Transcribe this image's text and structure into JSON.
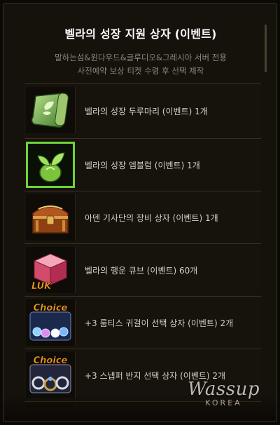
{
  "popup": {
    "title": "벨라의 성장 지원 상자 (이벤트)",
    "description_line1": "말하는섬&윈다우드&글루디오&그레시아 서버 전용",
    "description_line2": "사전예약 보상 티켓 수령 후 선택 제작"
  },
  "items": [
    {
      "icon": "green-scroll-icon",
      "label": "벨라의 성장 두루마리 (이벤트) 1개"
    },
    {
      "icon": "green-sprout-emblem-icon",
      "label": "벨라의 성장 엠블럼 (이벤트) 1개"
    },
    {
      "icon": "treasure-chest-icon",
      "label": "아덴 기사단의 장비 상자 (이벤트) 1개"
    },
    {
      "icon": "luck-cube-icon",
      "label": "벨라의 행운 큐브 (이벤트) 60개",
      "badge": "LUK"
    },
    {
      "icon": "earring-choice-box-icon",
      "label": "+3 룸티스 귀걸이 선택 상자 (이벤트) 2개",
      "badge": "Choice"
    },
    {
      "icon": "ring-choice-box-icon",
      "label": "+3 스냅퍼 반지 선택 상자 (이벤트) 2개",
      "badge": "Choice"
    },
    {
      "icon": "choice-box-icon",
      "label": "",
      "badge": "Choice"
    }
  ],
  "watermark": {
    "script": "Wassup",
    "sub": "KOREA"
  },
  "colors": {
    "background": "#15110b",
    "title": "#ffffff",
    "subtitle": "#8f8678",
    "item_text": "#d8d0c2",
    "selected_border": "#6fd43a",
    "choice_text": "#f0a020"
  }
}
